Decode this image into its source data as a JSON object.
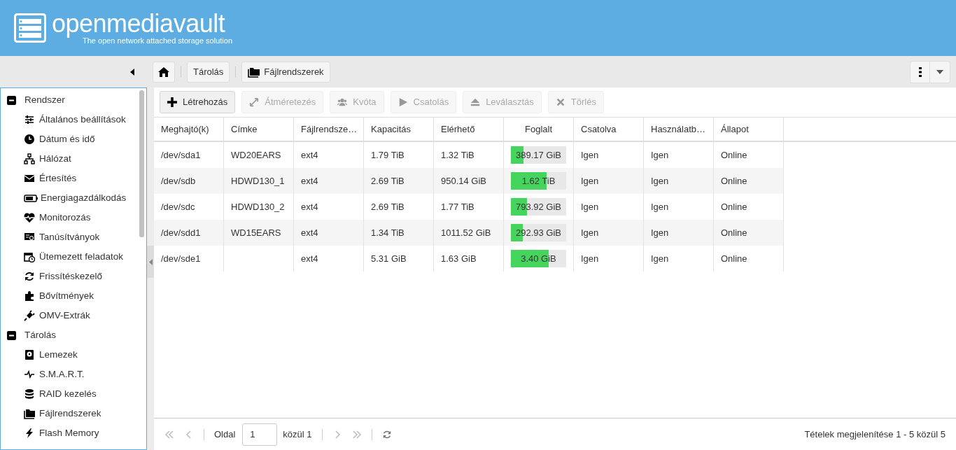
{
  "header": {
    "logo_text": "openmediavault",
    "tagline": "The open network attached storage solution"
  },
  "breadcrumb": [
    "Tárolás",
    "Fájlrendszerek"
  ],
  "sidebar": {
    "groups": [
      {
        "label": "Rendszer",
        "expanded": true,
        "items": [
          {
            "label": "Általános beállítások"
          },
          {
            "label": "Dátum és idő"
          },
          {
            "label": "Hálózat"
          },
          {
            "label": "Értesítés"
          },
          {
            "label": "Energiagazdálkodás"
          },
          {
            "label": "Monitorozás"
          },
          {
            "label": "Tanúsítványok"
          },
          {
            "label": "Ütemezett feladatok"
          },
          {
            "label": "Frissítéskezelő"
          },
          {
            "label": "Bővítmények"
          },
          {
            "label": "OMV-Extrák"
          }
        ]
      },
      {
        "label": "Tárolás",
        "expanded": true,
        "items": [
          {
            "label": "Lemezek"
          },
          {
            "label": "S.M.A.R.T."
          },
          {
            "label": "RAID kezelés"
          },
          {
            "label": "Fájlrendszerek",
            "selected": false
          },
          {
            "label": "Flash Memory"
          }
        ]
      }
    ]
  },
  "toolbar": [
    {
      "label": "Létrehozás",
      "disabled": false
    },
    {
      "label": "Átméretezés",
      "disabled": true
    },
    {
      "label": "Kvóta",
      "disabled": true
    },
    {
      "label": "Csatolás",
      "disabled": true
    },
    {
      "label": "Leválasztás",
      "disabled": true
    },
    {
      "label": "Törlés",
      "disabled": true
    }
  ],
  "table": {
    "columns": [
      "Meghajtó(k)",
      "Címke",
      "Fájlrendsze…",
      "Kapacitás",
      "Elérhető",
      "Foglalt",
      "Csatolva",
      "Használatb…",
      "Állapot"
    ],
    "rows": [
      {
        "device": "/dev/sda1",
        "label": "WD20EARS",
        "fs": "ext4",
        "capacity": "1.79 TiB",
        "available": "1.32 TiB",
        "used": "389.17 GiB",
        "level": 0.23,
        "mounted": "Igen",
        "referenced": "Igen",
        "status": "Online"
      },
      {
        "device": "/dev/sdb",
        "label": "HDWD130_1",
        "fs": "ext4",
        "capacity": "2.69 TiB",
        "available": "950.14 GiB",
        "used": "1.62 TiB",
        "level": 0.65,
        "mounted": "Igen",
        "referenced": "Igen",
        "status": "Online"
      },
      {
        "device": "/dev/sdc",
        "label": "HDWD130_2",
        "fs": "ext4",
        "capacity": "2.69 TiB",
        "available": "1.77 TiB",
        "used": "793.92 GiB",
        "level": 0.29,
        "mounted": "Igen",
        "referenced": "Igen",
        "status": "Online"
      },
      {
        "device": "/dev/sdd1",
        "label": "WD15EARS",
        "fs": "ext4",
        "capacity": "1.34 TiB",
        "available": "1011.52 GiB",
        "used": "292.93 GiB",
        "level": 0.22,
        "mounted": "Igen",
        "referenced": "Igen",
        "status": "Online"
      },
      {
        "device": "/dev/sde1",
        "label": "",
        "fs": "ext4",
        "capacity": "5.31 GiB",
        "available": "1.63 GiB",
        "used": "3.40 GiB",
        "level": 0.68,
        "mounted": "Igen",
        "referenced": "Igen",
        "status": "Online"
      }
    ]
  },
  "pager": {
    "page_label": "Oldal",
    "page": "1",
    "of_label": "közül 1",
    "summary": "Tételek megjelenítése 1 - 5 közül 5"
  }
}
